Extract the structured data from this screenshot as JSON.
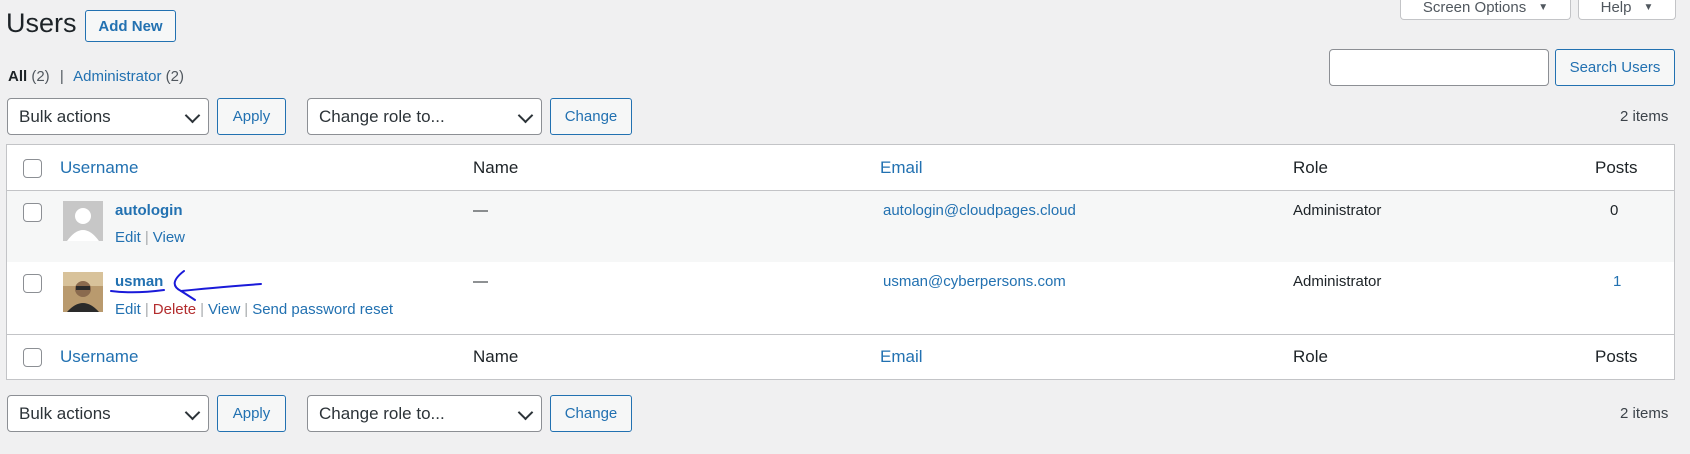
{
  "header": {
    "title": "Users",
    "add_new": "Add New",
    "screen_options": "Screen Options",
    "help": "Help"
  },
  "views": {
    "all_label": "All",
    "all_count": "(2)",
    "admin_label": "Administrator",
    "admin_count": "(2)"
  },
  "search": {
    "value": "",
    "button": "Search Users"
  },
  "toolbar": {
    "bulk_actions": "Bulk actions",
    "apply": "Apply",
    "change_role": "Change role to...",
    "change": "Change",
    "items": "2 items"
  },
  "columns": {
    "username": "Username",
    "name": "Name",
    "email": "Email",
    "role": "Role",
    "posts": "Posts"
  },
  "users": [
    {
      "username": "autologin",
      "name": "—",
      "email": "autologin@cloudpages.cloud",
      "role": "Administrator",
      "posts": "0",
      "actions": {
        "edit": "Edit",
        "view": "View"
      }
    },
    {
      "username": "usman",
      "name": "—",
      "email": "usman@cyberpersons.com",
      "role": "Administrator",
      "posts": "1",
      "actions": {
        "edit": "Edit",
        "delete": "Delete",
        "view": "View",
        "reset": "Send password reset"
      }
    }
  ],
  "colors": {
    "link": "#2271b1",
    "delete": "#b32d2e",
    "annotation": "#1a1ad9"
  }
}
